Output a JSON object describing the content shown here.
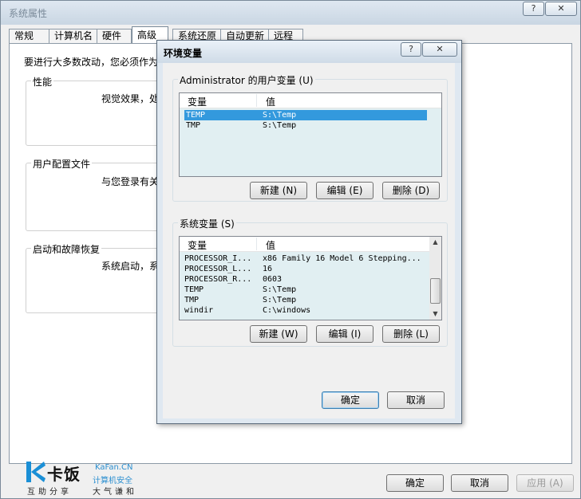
{
  "outer_window": {
    "title": "系统属性",
    "tabs": [
      "常规",
      "计算机名",
      "硬件",
      "高级",
      "系统还原",
      "自动更新",
      "远程"
    ],
    "active_tab": "高级",
    "intro": "要进行大多数改动，您必须作为",
    "groups": [
      {
        "title": "性能",
        "text": "视觉效果，处"
      },
      {
        "title": "用户配置文件",
        "text": "与您登录有关"
      },
      {
        "title": "启动和故障恢复",
        "text": "系统启动，系"
      }
    ],
    "buttons": {
      "ok": "确定",
      "cancel": "取消",
      "apply": "应用 (A)"
    },
    "help_glyph": "?",
    "close_glyph": "✕"
  },
  "watermark": {
    "name": "卡饭",
    "tagline1": "互助分享",
    "site": "KaFan.CN",
    "tagline2": "计算机安全",
    "tagline3": "大气谦和"
  },
  "dialog": {
    "title": "环境变量",
    "help_glyph": "?",
    "close_glyph": "✕",
    "user_vars": {
      "label": "Administrator 的用户变量 (U)",
      "columns": [
        "变量",
        "值"
      ],
      "rows": [
        {
          "name": "TEMP",
          "value": "S:\\Temp",
          "selected": true
        },
        {
          "name": "TMP",
          "value": "S:\\Temp",
          "selected": false
        }
      ],
      "buttons": {
        "new": "新建 (N)",
        "edit": "编辑 (E)",
        "delete": "删除 (D)"
      }
    },
    "system_vars": {
      "label": "系统变量 (S)",
      "columns": [
        "变量",
        "值"
      ],
      "rows": [
        {
          "name": "PROCESSOR_I...",
          "value": "x86 Family 16 Model 6 Stepping..."
        },
        {
          "name": "PROCESSOR_L...",
          "value": "16"
        },
        {
          "name": "PROCESSOR_R...",
          "value": "0603"
        },
        {
          "name": "TEMP",
          "value": "S:\\Temp"
        },
        {
          "name": "TMP",
          "value": "S:\\Temp"
        },
        {
          "name": "windir",
          "value": "C:\\windows"
        }
      ],
      "buttons": {
        "new": "新建 (W)",
        "edit": "编辑 (I)",
        "delete": "删除 (L)"
      }
    },
    "ok": "确定",
    "cancel": "取消"
  }
}
